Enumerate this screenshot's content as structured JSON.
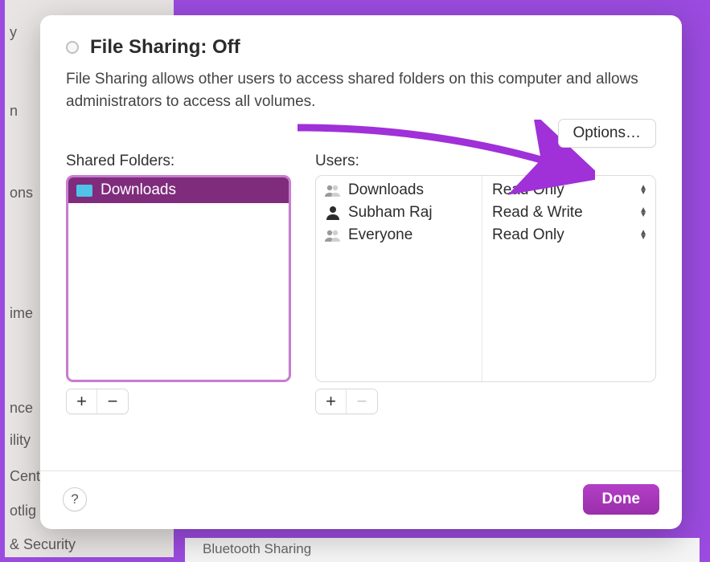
{
  "title": "File Sharing: Off",
  "description": "File Sharing allows other users to access shared folders on this computer and allows administrators to access all volumes.",
  "buttons": {
    "options": "Options…",
    "done": "Done",
    "help": "?"
  },
  "labels": {
    "shared_folders": "Shared Folders:",
    "users": "Users:"
  },
  "shared_folders": [
    {
      "name": "Downloads"
    }
  ],
  "users": [
    {
      "name": "Downloads",
      "icon": "group",
      "permission": "Read Only"
    },
    {
      "name": "Subham Raj",
      "icon": "person",
      "permission": "Read & Write"
    },
    {
      "name": "Everyone",
      "icon": "group",
      "permission": "Read Only"
    }
  ],
  "background_sidebar": [
    "y",
    "n",
    "ons",
    "ime",
    "nce",
    "ility",
    "Cent",
    "otlig",
    "& Security"
  ],
  "background_right": "Bluetooth Sharing"
}
